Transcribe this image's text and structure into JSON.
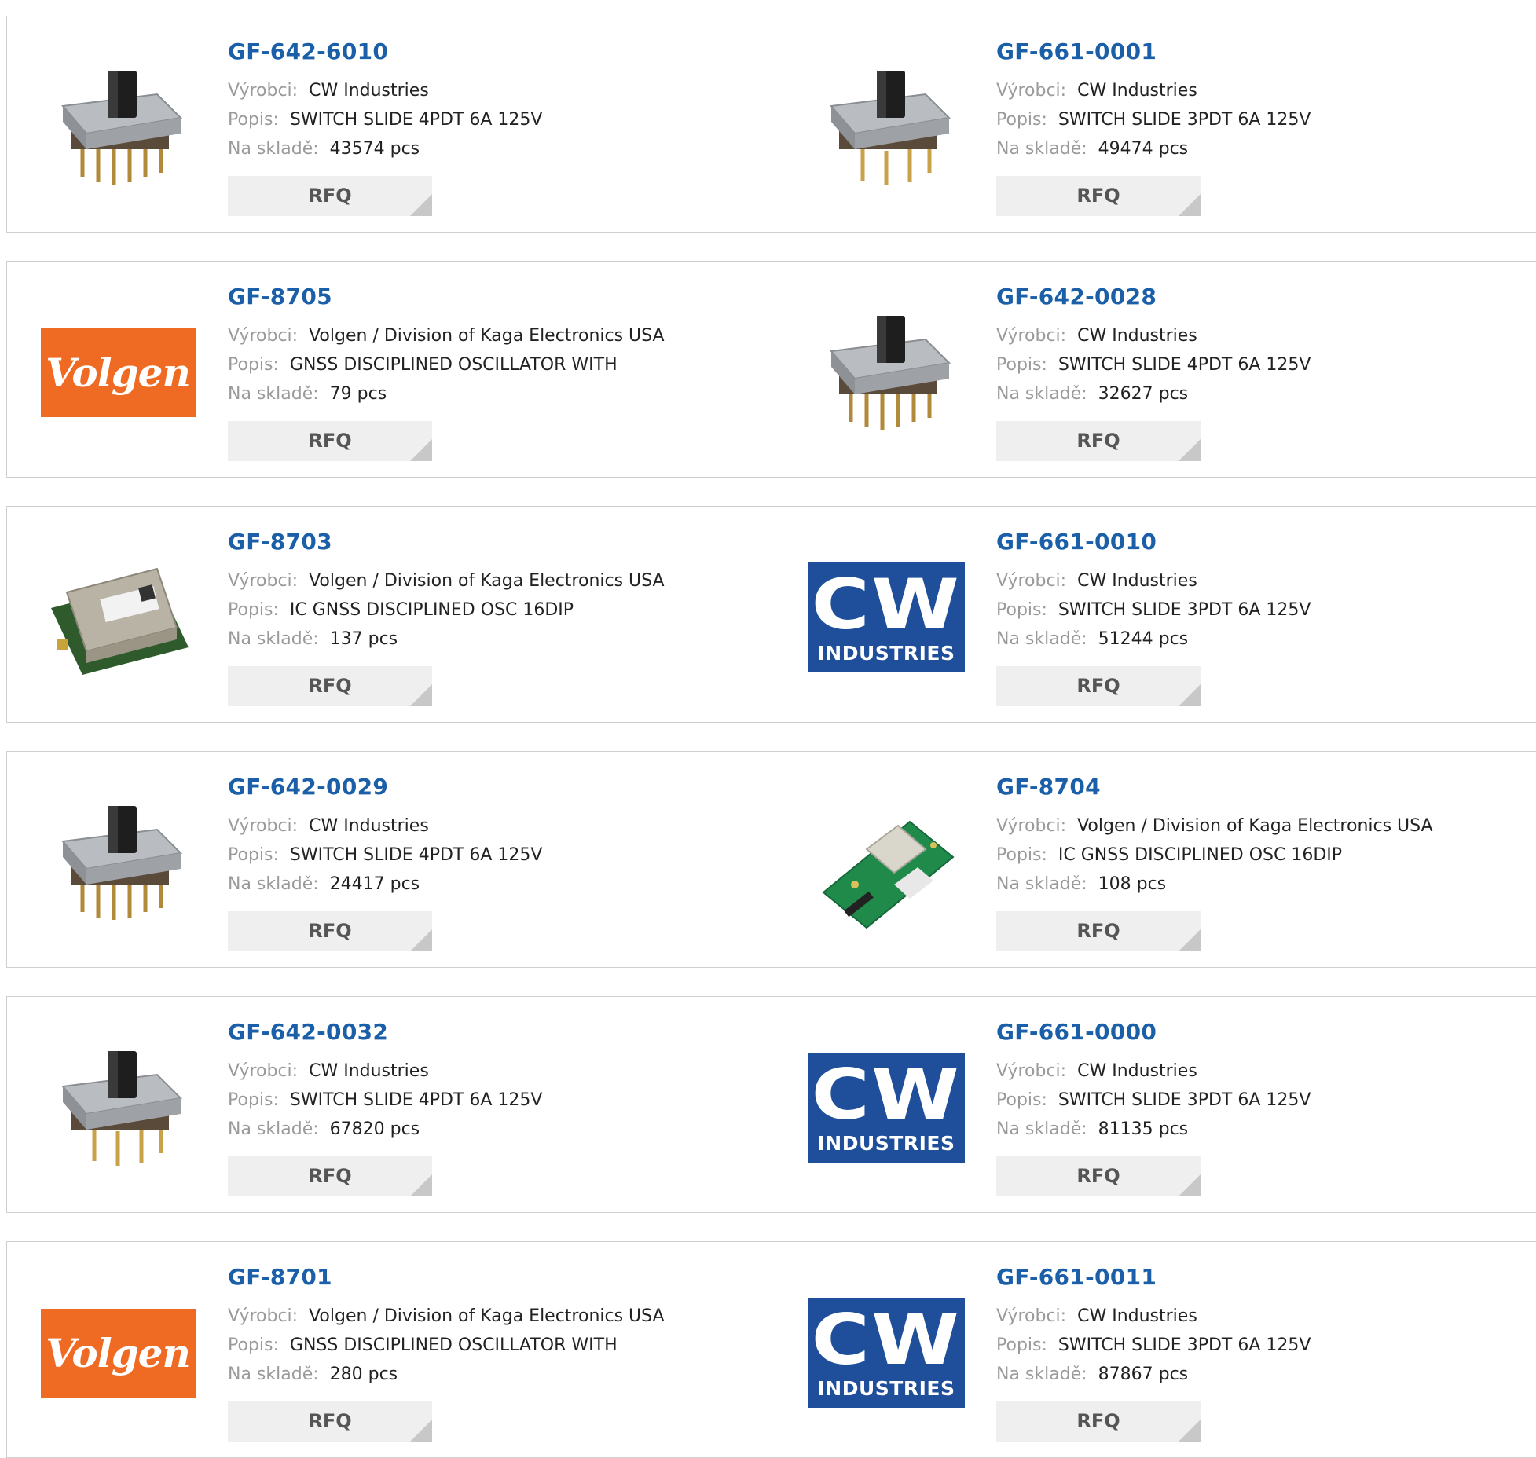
{
  "labels": {
    "manufacturer": "Výrobci:",
    "description": "Popis:",
    "stock": "Na skladě:",
    "rfq": "RFQ"
  },
  "products": [
    {
      "part": "GF-642-6010",
      "manufacturer": "CW Industries",
      "description": "SWITCH SLIDE 4PDT 6A 125V",
      "stock": "43574 pcs",
      "image": "slide-switch-photo"
    },
    {
      "part": "GF-661-0001",
      "manufacturer": "CW Industries",
      "description": "SWITCH SLIDE 3PDT 6A 125V",
      "stock": "49474 pcs",
      "image": "slide-switch-photo"
    },
    {
      "part": "GF-8705",
      "manufacturer": "Volgen / Division of Kaga Electronics USA",
      "description": "GNSS DISCIPLINED OSCILLATOR WITH",
      "stock": "79 pcs",
      "image": "volgen-logo",
      "logo_text": "Volgen"
    },
    {
      "part": "GF-642-0028",
      "manufacturer": "CW Industries",
      "description": "SWITCH SLIDE 4PDT 6A 125V",
      "stock": "32627 pcs",
      "image": "slide-switch-photo"
    },
    {
      "part": "GF-8703",
      "manufacturer": "Volgen / Division of Kaga Electronics USA",
      "description": "IC GNSS DISCIPLINED OSC 16DIP",
      "stock": "137 pcs",
      "image": "oscillator-module-photo"
    },
    {
      "part": "GF-661-0010",
      "manufacturer": "CW Industries",
      "description": "SWITCH SLIDE 3PDT 6A 125V",
      "stock": "51244 pcs",
      "image": "cw-industries-logo",
      "logo_text": "CW",
      "logo_subtext": "INDUSTRIES"
    },
    {
      "part": "GF-642-0029",
      "manufacturer": "CW Industries",
      "description": "SWITCH SLIDE 4PDT 6A 125V",
      "stock": "24417 pcs",
      "image": "slide-switch-photo"
    },
    {
      "part": "GF-8704",
      "manufacturer": "Volgen / Division of Kaga Electronics USA",
      "description": "IC GNSS DISCIPLINED OSC 16DIP",
      "stock": "108 pcs",
      "image": "pcb-module-photo"
    },
    {
      "part": "GF-642-0032",
      "manufacturer": "CW Industries",
      "description": "SWITCH SLIDE 4PDT 6A 125V",
      "stock": "67820 pcs",
      "image": "slide-switch-photo"
    },
    {
      "part": "GF-661-0000",
      "manufacturer": "CW Industries",
      "description": "SWITCH SLIDE 3PDT 6A 125V",
      "stock": "81135 pcs",
      "image": "cw-industries-logo",
      "logo_text": "CW",
      "logo_subtext": "INDUSTRIES"
    },
    {
      "part": "GF-8701",
      "manufacturer": "Volgen / Division of Kaga Electronics USA",
      "description": "GNSS DISCIPLINED OSCILLATOR WITH",
      "stock": "280 pcs",
      "image": "volgen-logo",
      "logo_text": "Volgen"
    },
    {
      "part": "GF-661-0011",
      "manufacturer": "CW Industries",
      "description": "SWITCH SLIDE 3PDT 6A 125V",
      "stock": "87867 pcs",
      "image": "cw-industries-logo",
      "logo_text": "CW",
      "logo_subtext": "INDUSTRIES"
    }
  ],
  "colors": {
    "part_link": "#1a5fa8",
    "label": "#9a9a9a",
    "border": "#cfcfcf",
    "rfq_bg": "#efefef",
    "volgen_orange": "#ef6a22",
    "cw_blue": "#1f4f9a"
  }
}
